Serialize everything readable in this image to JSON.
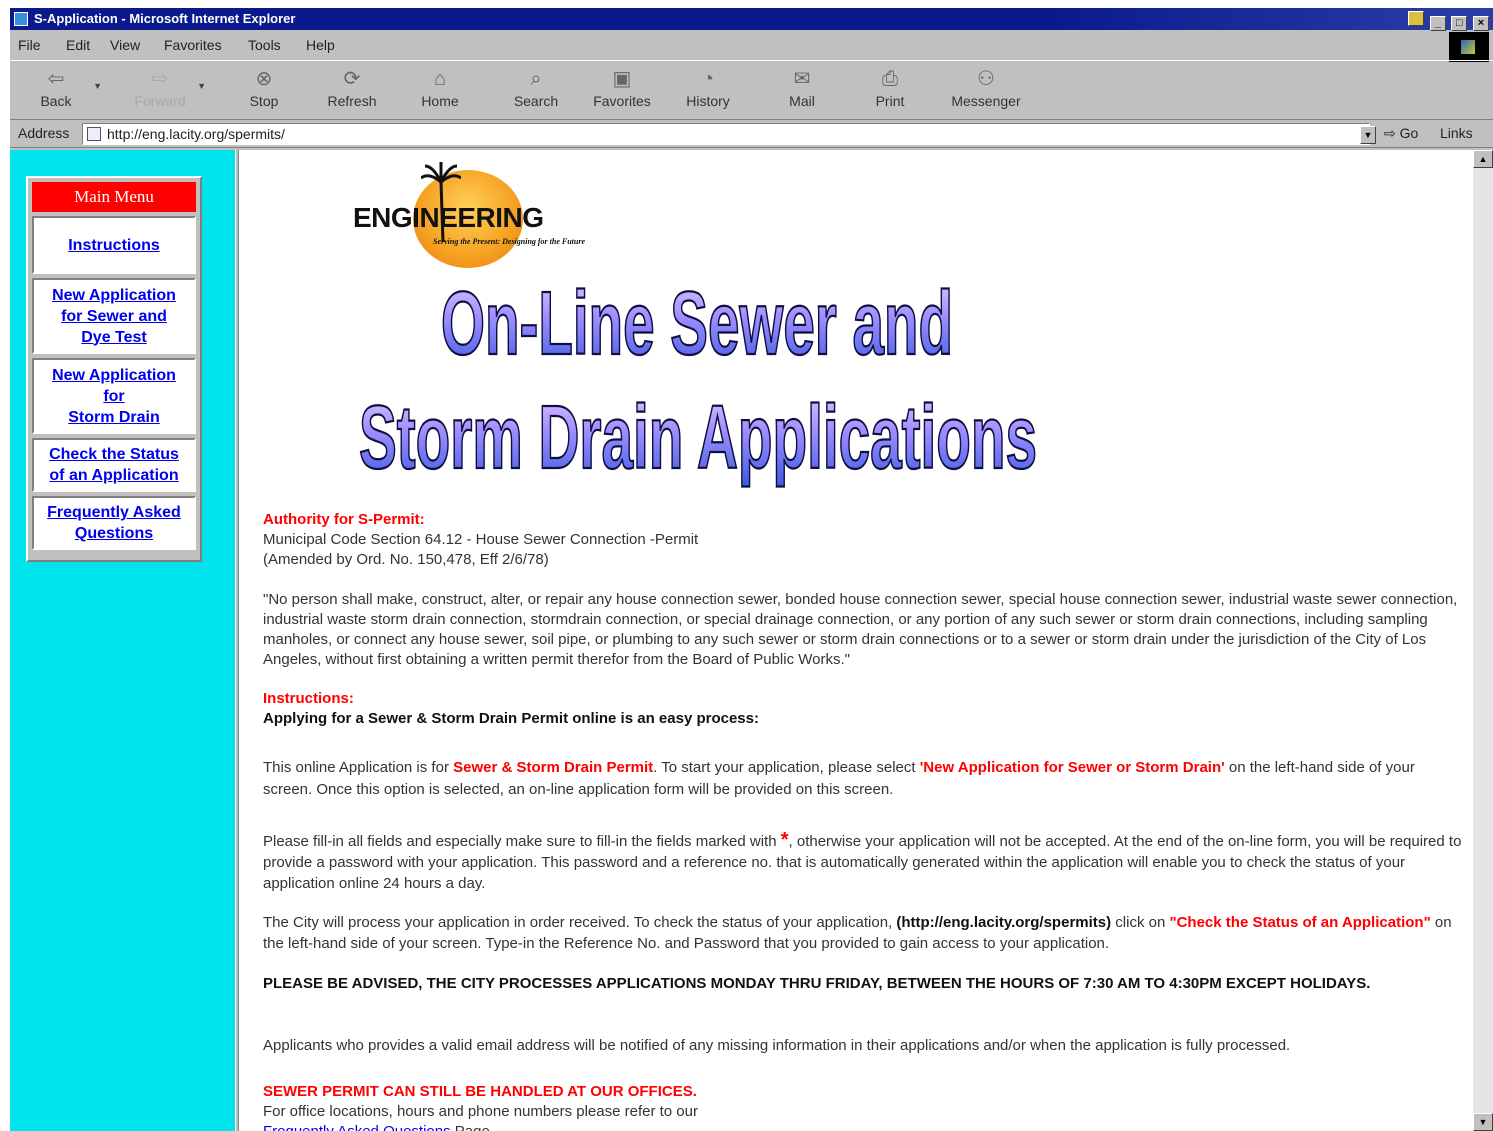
{
  "window": {
    "title": "S-Application - Microsoft Internet Explorer",
    "controls": [
      "_",
      "□",
      "×"
    ]
  },
  "menubar": {
    "file": "File",
    "edit": "Edit",
    "view": "View",
    "favorites": "Favorites",
    "tools": "Tools",
    "help": "Help"
  },
  "toolbar": {
    "back": "Back",
    "forward": "Forward",
    "stop": "Stop",
    "refresh": "Refresh",
    "home": "Home",
    "search": "Search",
    "favorites": "Favorites",
    "history": "History",
    "mail": "Mail",
    "print": "Print",
    "messenger": "Messenger"
  },
  "addressbar": {
    "label": "Address",
    "url": "http://eng.lacity.org/spermits/",
    "go": "Go",
    "links": "Links"
  },
  "menu": {
    "title": "Main Menu",
    "items": [
      {
        "line1": "Instructions",
        "line2": "",
        "line3": ""
      },
      {
        "line1": "New Application",
        "line2": "for Sewer and",
        "line3": "Dye Test"
      },
      {
        "line1": "New Application",
        "line2": "for",
        "line3": "Storm Drain"
      },
      {
        "line1": "Check the Status",
        "line2": "of an Application",
        "line3": ""
      },
      {
        "line1": "Frequently Asked",
        "line2": "Questions",
        "line3": ""
      }
    ]
  },
  "logo": {
    "word": "ENGINEERING",
    "tagline": "Serving the Present: Designing for the Future"
  },
  "headline": {
    "line1": "On-Line Sewer and",
    "line2": "Storm Drain Applications"
  },
  "authority": {
    "heading": "Authority for S-Permit:",
    "code": "Municipal Code Section 64.12 - House Sewer Connection -Permit",
    "amended": "(Amended by Ord. No. 150,478, Eff 2/6/78)",
    "quote": "\"No person shall make, construct, alter, or repair any house connection sewer, bonded house connection sewer, special house connection sewer, industrial waste sewer connection, industrial waste storm drain connection, stormdrain connection, or special drainage connection, or any portion of any such sewer or storm drain connections, including sampling manholes, or connect any house sewer, soil pipe, or plumbing to any such sewer or storm drain connections or to a sewer or storm drain under the jurisdiction of the City of Los Angeles, without first obtaining a written permit therefor from the Board of Public Works.\""
  },
  "instructions": {
    "heading": "Instructions:",
    "subheading": "Applying for a Sewer & Storm Drain Permit online is an easy process:",
    "p1_a": "This online Application is for ",
    "p1_b": "Sewer & Storm Drain Permit",
    "p1_c": ". To start your application, please select ",
    "p1_d": "'New Application for Sewer or Storm Drain'",
    "p1_e": " on the left-hand side of your screen. Once this option is selected, an on-line application form will be provided on this screen.",
    "p2_a": "Please fill-in all fields and especially make sure to fill-in the fields marked with ",
    "p2_star": "*",
    "p2_b": ", otherwise your application will not be accepted. At the end of the on-line form, you will be required to provide a password with your application. This password and a reference no. that is automatically generated within the application will enable you to check the status of your application online 24 hours a day.",
    "p3_a": "The City will process your application in order received. To check the status of your application, ",
    "p3_url": "(http://eng.lacity.org/spermits)",
    "p3_b": " click on ",
    "p3_c": "\"Check the Status of an Application\"",
    "p3_d": " on the left-hand side of your screen. Type-in the Reference No. and Password that you provided to gain access to your application.",
    "advised": "PLEASE BE ADVISED, THE CITY PROCESSES APPLICATIONS MONDAY THRU FRIDAY, BETWEEN THE HOURS OF 7:30 AM TO 4:30PM EXCEPT HOLIDAYS.",
    "email": "Applicants who provides a valid email address will be notified of any missing information in their applications and/or when the application is fully processed."
  },
  "offices": {
    "heading": "SEWER PERMIT CAN STILL BE HANDLED AT OUR OFFICES.",
    "line1": "For office locations, hours and phone numbers please refer to our",
    "link": "Frequently Asked Questions",
    "line2_tail": " Page."
  },
  "colors": {
    "titlebar": "#0a1a8c",
    "leftframe": "#00e4ec",
    "menu_title": "#ff0000",
    "link": "#0000ee",
    "alert_red": "#ff0000"
  }
}
